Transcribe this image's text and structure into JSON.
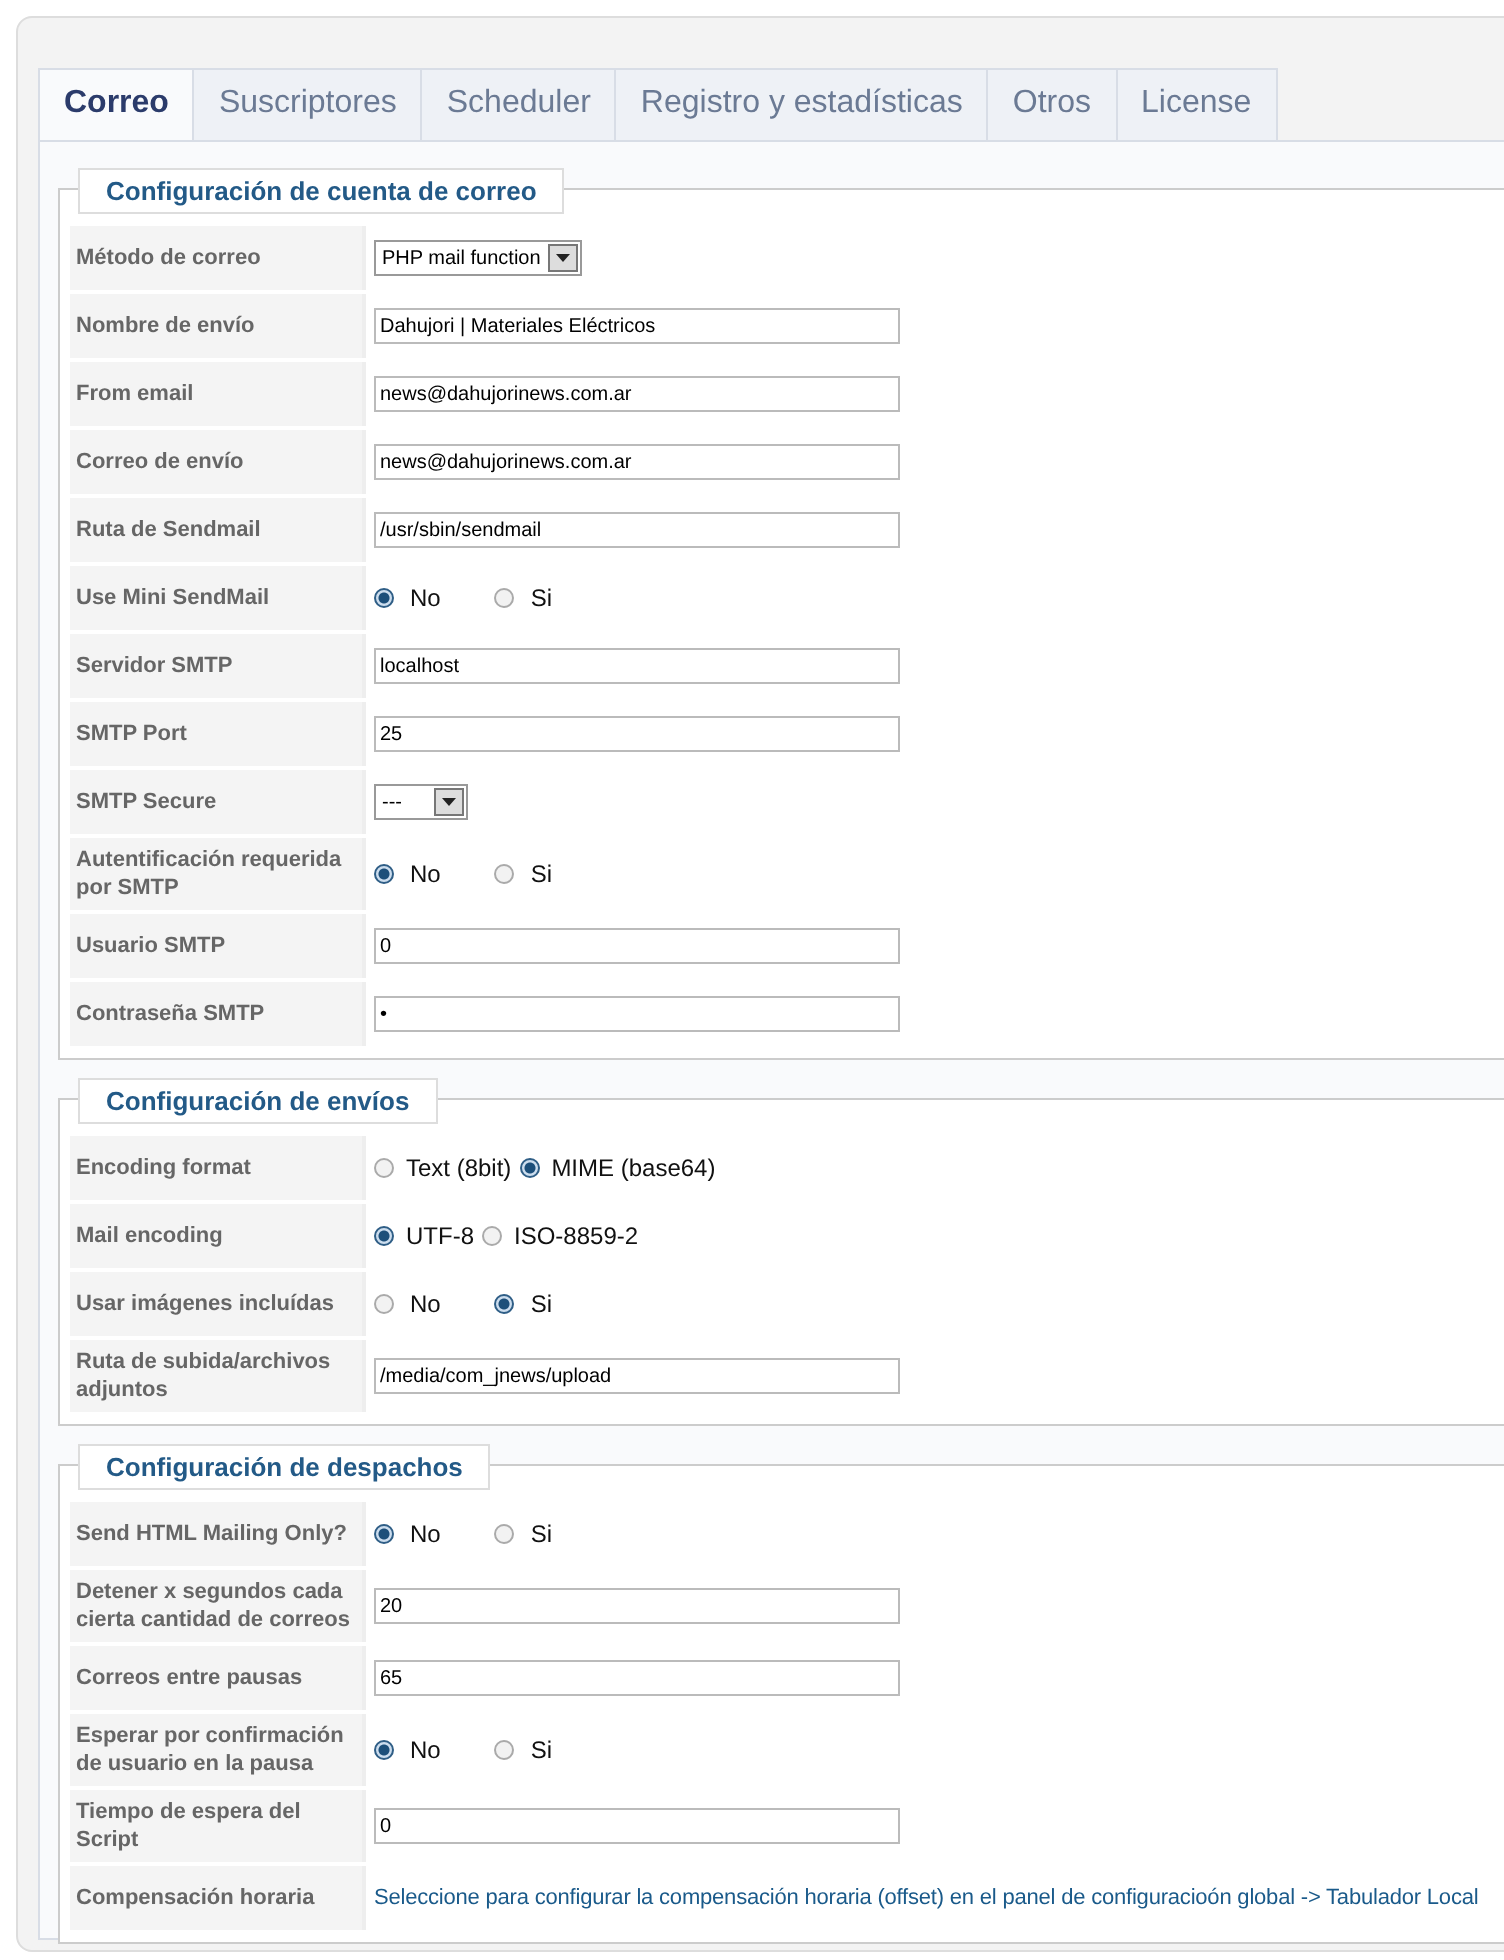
{
  "tabs": [
    {
      "label": "Correo",
      "selected": true
    },
    {
      "label": "Suscriptores",
      "selected": false
    },
    {
      "label": "Scheduler",
      "selected": false
    },
    {
      "label": "Registro y estadísticas",
      "selected": false
    },
    {
      "label": "Otros",
      "selected": false
    },
    {
      "label": "License",
      "selected": false
    }
  ],
  "sections": [
    {
      "title": "Configuración de cuenta de correo",
      "rows": [
        {
          "label": "Método de correo",
          "kind": "select",
          "value": "PHP mail function"
        },
        {
          "label": "Nombre de envío",
          "kind": "text",
          "value": "Dahujori | Materiales Eléctricos"
        },
        {
          "label": "From email",
          "kind": "text",
          "value": "news@dahujorinews.com.ar"
        },
        {
          "label": "Correo de envío",
          "kind": "text",
          "value": "news@dahujorinews.com.ar"
        },
        {
          "label": "Ruta de Sendmail",
          "kind": "text",
          "value": "/usr/sbin/sendmail"
        },
        {
          "label": "Use Mini SendMail",
          "kind": "radio",
          "options": [
            {
              "label": "No",
              "selected": true
            },
            {
              "label": "Si",
              "selected": false
            }
          ]
        },
        {
          "label": "Servidor SMTP",
          "kind": "text",
          "value": "localhost"
        },
        {
          "label": "SMTP Port",
          "kind": "text",
          "value": "25"
        },
        {
          "label": "SMTP Secure",
          "kind": "select",
          "value": "---"
        },
        {
          "label": "Autentificación requerida por SMTP",
          "kind": "radio",
          "options": [
            {
              "label": "No",
              "selected": true
            },
            {
              "label": "Si",
              "selected": false
            }
          ]
        },
        {
          "label": "Usuario SMTP",
          "kind": "text",
          "value": "0"
        },
        {
          "label": "Contraseña SMTP",
          "kind": "text",
          "value": "•"
        }
      ]
    },
    {
      "title": "Configuración de envíos",
      "rows": [
        {
          "label": "Encoding format",
          "kind": "radio",
          "compact": true,
          "options": [
            {
              "label": "Text (8bit)",
              "selected": false
            },
            {
              "label": "MIME (base64)",
              "selected": true
            }
          ]
        },
        {
          "label": "Mail encoding",
          "kind": "radio",
          "compact": true,
          "options": [
            {
              "label": "UTF-8",
              "selected": true
            },
            {
              "label": "ISO-8859-2",
              "selected": false
            }
          ]
        },
        {
          "label": "Usar imágenes incluídas",
          "kind": "radio",
          "options": [
            {
              "label": "No",
              "selected": false
            },
            {
              "label": "Si",
              "selected": true
            }
          ]
        },
        {
          "label": "Ruta de subida/archivos adjuntos",
          "kind": "text",
          "value": "/media/com_jnews/upload"
        }
      ]
    },
    {
      "title": "Configuración de despachos",
      "rows": [
        {
          "label": "Send HTML Mailing Only?",
          "kind": "radio",
          "options": [
            {
              "label": "No",
              "selected": true
            },
            {
              "label": "Si",
              "selected": false
            }
          ]
        },
        {
          "label": "Detener x segundos cada cierta cantidad de correos",
          "kind": "text",
          "value": "20"
        },
        {
          "label": "Correos entre pausas",
          "kind": "text",
          "value": "65"
        },
        {
          "label": "Esperar por confirmación de usuario en la pausa",
          "kind": "radio",
          "options": [
            {
              "label": "No",
              "selected": true
            },
            {
              "label": "Si",
              "selected": false
            }
          ]
        },
        {
          "label": "Tiempo de espera del Script",
          "kind": "text",
          "value": "0"
        },
        {
          "label": "Compensación horaria",
          "kind": "link",
          "value": "Seleccione para configurar la compensación horaria (offset) en el panel de configuracioón global -> Tabulador Local"
        }
      ]
    }
  ]
}
